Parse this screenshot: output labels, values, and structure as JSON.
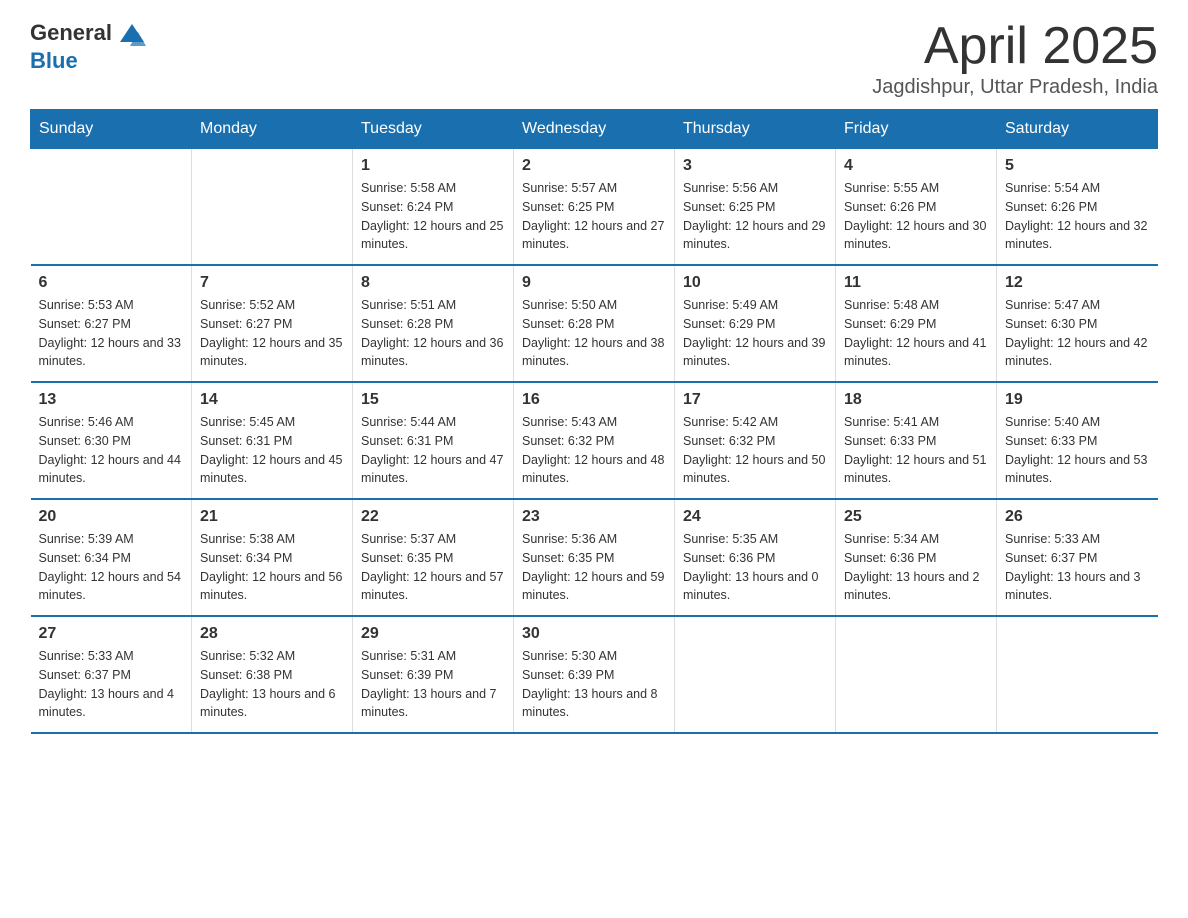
{
  "logo": {
    "text_general": "General",
    "text_blue": "Blue"
  },
  "header": {
    "month_year": "April 2025",
    "location": "Jagdishpur, Uttar Pradesh, India"
  },
  "days_of_week": [
    "Sunday",
    "Monday",
    "Tuesday",
    "Wednesday",
    "Thursday",
    "Friday",
    "Saturday"
  ],
  "weeks": [
    [
      {
        "day": "",
        "info": ""
      },
      {
        "day": "",
        "info": ""
      },
      {
        "day": "1",
        "info": "Sunrise: 5:58 AM\nSunset: 6:24 PM\nDaylight: 12 hours and 25 minutes."
      },
      {
        "day": "2",
        "info": "Sunrise: 5:57 AM\nSunset: 6:25 PM\nDaylight: 12 hours and 27 minutes."
      },
      {
        "day": "3",
        "info": "Sunrise: 5:56 AM\nSunset: 6:25 PM\nDaylight: 12 hours and 29 minutes."
      },
      {
        "day": "4",
        "info": "Sunrise: 5:55 AM\nSunset: 6:26 PM\nDaylight: 12 hours and 30 minutes."
      },
      {
        "day": "5",
        "info": "Sunrise: 5:54 AM\nSunset: 6:26 PM\nDaylight: 12 hours and 32 minutes."
      }
    ],
    [
      {
        "day": "6",
        "info": "Sunrise: 5:53 AM\nSunset: 6:27 PM\nDaylight: 12 hours and 33 minutes."
      },
      {
        "day": "7",
        "info": "Sunrise: 5:52 AM\nSunset: 6:27 PM\nDaylight: 12 hours and 35 minutes."
      },
      {
        "day": "8",
        "info": "Sunrise: 5:51 AM\nSunset: 6:28 PM\nDaylight: 12 hours and 36 minutes."
      },
      {
        "day": "9",
        "info": "Sunrise: 5:50 AM\nSunset: 6:28 PM\nDaylight: 12 hours and 38 minutes."
      },
      {
        "day": "10",
        "info": "Sunrise: 5:49 AM\nSunset: 6:29 PM\nDaylight: 12 hours and 39 minutes."
      },
      {
        "day": "11",
        "info": "Sunrise: 5:48 AM\nSunset: 6:29 PM\nDaylight: 12 hours and 41 minutes."
      },
      {
        "day": "12",
        "info": "Sunrise: 5:47 AM\nSunset: 6:30 PM\nDaylight: 12 hours and 42 minutes."
      }
    ],
    [
      {
        "day": "13",
        "info": "Sunrise: 5:46 AM\nSunset: 6:30 PM\nDaylight: 12 hours and 44 minutes."
      },
      {
        "day": "14",
        "info": "Sunrise: 5:45 AM\nSunset: 6:31 PM\nDaylight: 12 hours and 45 minutes."
      },
      {
        "day": "15",
        "info": "Sunrise: 5:44 AM\nSunset: 6:31 PM\nDaylight: 12 hours and 47 minutes."
      },
      {
        "day": "16",
        "info": "Sunrise: 5:43 AM\nSunset: 6:32 PM\nDaylight: 12 hours and 48 minutes."
      },
      {
        "day": "17",
        "info": "Sunrise: 5:42 AM\nSunset: 6:32 PM\nDaylight: 12 hours and 50 minutes."
      },
      {
        "day": "18",
        "info": "Sunrise: 5:41 AM\nSunset: 6:33 PM\nDaylight: 12 hours and 51 minutes."
      },
      {
        "day": "19",
        "info": "Sunrise: 5:40 AM\nSunset: 6:33 PM\nDaylight: 12 hours and 53 minutes."
      }
    ],
    [
      {
        "day": "20",
        "info": "Sunrise: 5:39 AM\nSunset: 6:34 PM\nDaylight: 12 hours and 54 minutes."
      },
      {
        "day": "21",
        "info": "Sunrise: 5:38 AM\nSunset: 6:34 PM\nDaylight: 12 hours and 56 minutes."
      },
      {
        "day": "22",
        "info": "Sunrise: 5:37 AM\nSunset: 6:35 PM\nDaylight: 12 hours and 57 minutes."
      },
      {
        "day": "23",
        "info": "Sunrise: 5:36 AM\nSunset: 6:35 PM\nDaylight: 12 hours and 59 minutes."
      },
      {
        "day": "24",
        "info": "Sunrise: 5:35 AM\nSunset: 6:36 PM\nDaylight: 13 hours and 0 minutes."
      },
      {
        "day": "25",
        "info": "Sunrise: 5:34 AM\nSunset: 6:36 PM\nDaylight: 13 hours and 2 minutes."
      },
      {
        "day": "26",
        "info": "Sunrise: 5:33 AM\nSunset: 6:37 PM\nDaylight: 13 hours and 3 minutes."
      }
    ],
    [
      {
        "day": "27",
        "info": "Sunrise: 5:33 AM\nSunset: 6:37 PM\nDaylight: 13 hours and 4 minutes."
      },
      {
        "day": "28",
        "info": "Sunrise: 5:32 AM\nSunset: 6:38 PM\nDaylight: 13 hours and 6 minutes."
      },
      {
        "day": "29",
        "info": "Sunrise: 5:31 AM\nSunset: 6:39 PM\nDaylight: 13 hours and 7 minutes."
      },
      {
        "day": "30",
        "info": "Sunrise: 5:30 AM\nSunset: 6:39 PM\nDaylight: 13 hours and 8 minutes."
      },
      {
        "day": "",
        "info": ""
      },
      {
        "day": "",
        "info": ""
      },
      {
        "day": "",
        "info": ""
      }
    ]
  ]
}
